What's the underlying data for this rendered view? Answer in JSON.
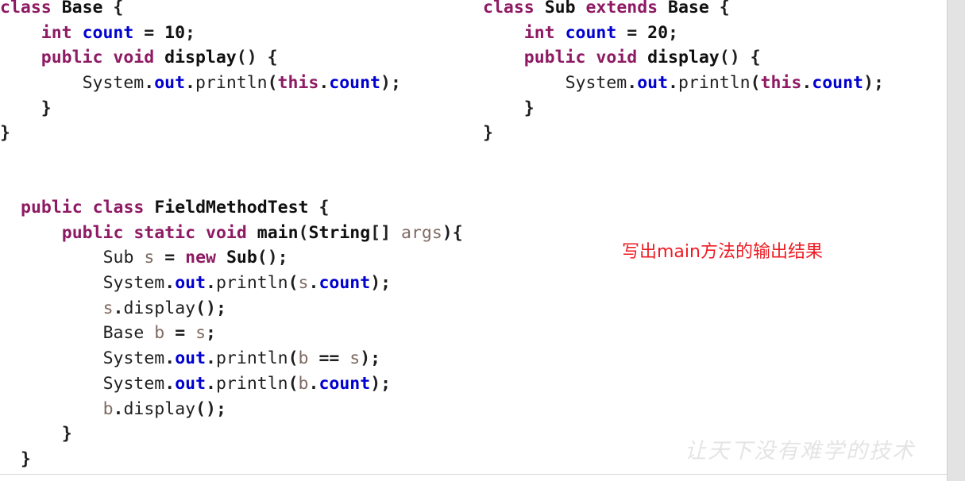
{
  "slide": {
    "background_color": "#ffffff",
    "gutter_color": "#e3e3e3",
    "rule_color": "#d4d4d4"
  },
  "palette": {
    "keyword": "#8E1A63",
    "identifier": "#101010",
    "plain": "#1f1f1f",
    "field": "#0000D0",
    "variable": "#7E6A62",
    "annotation_red": "#ED1C24",
    "watermark_gray": "#e4e4e4"
  },
  "code_blocks": [
    {
      "id": "block-base",
      "name": "base-class-code",
      "lines": [
        [
          {
            "t": "class",
            "c": "kw"
          },
          {
            "t": " ",
            "c": "plain"
          },
          {
            "t": "Base",
            "c": "id"
          },
          {
            "t": " ",
            "c": "plain"
          },
          {
            "t": "{",
            "c": "punc"
          }
        ],
        [
          {
            "t": "    ",
            "c": "plain"
          },
          {
            "t": "int",
            "c": "kw"
          },
          {
            "t": " ",
            "c": "plain"
          },
          {
            "t": "count",
            "c": "field"
          },
          {
            "t": " = ",
            "c": "punc"
          },
          {
            "t": "10",
            "c": "num"
          },
          {
            "t": ";",
            "c": "punc"
          }
        ],
        [
          {
            "t": "    ",
            "c": "plain"
          },
          {
            "t": "public",
            "c": "kw"
          },
          {
            "t": " ",
            "c": "plain"
          },
          {
            "t": "void",
            "c": "kw"
          },
          {
            "t": " ",
            "c": "plain"
          },
          {
            "t": "display",
            "c": "id"
          },
          {
            "t": "() {",
            "c": "punc"
          }
        ],
        [
          {
            "t": "        ",
            "c": "plain"
          },
          {
            "t": "System",
            "c": "plain"
          },
          {
            "t": ".",
            "c": "punc"
          },
          {
            "t": "out",
            "c": "field"
          },
          {
            "t": ".",
            "c": "punc"
          },
          {
            "t": "println",
            "c": "plain"
          },
          {
            "t": "(",
            "c": "punc"
          },
          {
            "t": "this",
            "c": "kw"
          },
          {
            "t": ".",
            "c": "punc"
          },
          {
            "t": "count",
            "c": "field"
          },
          {
            "t": ");",
            "c": "punc"
          }
        ],
        [
          {
            "t": "    ",
            "c": "plain"
          },
          {
            "t": "}",
            "c": "punc"
          }
        ],
        [
          {
            "t": "}",
            "c": "punc"
          }
        ]
      ]
    },
    {
      "id": "block-sub",
      "name": "sub-class-code",
      "lines": [
        [
          {
            "t": "class",
            "c": "kw"
          },
          {
            "t": " ",
            "c": "plain"
          },
          {
            "t": "Sub",
            "c": "id"
          },
          {
            "t": " ",
            "c": "plain"
          },
          {
            "t": "extends",
            "c": "kw"
          },
          {
            "t": " ",
            "c": "plain"
          },
          {
            "t": "Base",
            "c": "id"
          },
          {
            "t": " ",
            "c": "plain"
          },
          {
            "t": "{",
            "c": "punc"
          }
        ],
        [
          {
            "t": "    ",
            "c": "plain"
          },
          {
            "t": "int",
            "c": "kw"
          },
          {
            "t": " ",
            "c": "plain"
          },
          {
            "t": "count",
            "c": "field"
          },
          {
            "t": " = ",
            "c": "punc"
          },
          {
            "t": "20",
            "c": "num"
          },
          {
            "t": ";",
            "c": "punc"
          }
        ],
        [
          {
            "t": "    ",
            "c": "plain"
          },
          {
            "t": "public",
            "c": "kw"
          },
          {
            "t": " ",
            "c": "plain"
          },
          {
            "t": "void",
            "c": "kw"
          },
          {
            "t": " ",
            "c": "plain"
          },
          {
            "t": "display",
            "c": "id"
          },
          {
            "t": "() {",
            "c": "punc"
          }
        ],
        [
          {
            "t": "        ",
            "c": "plain"
          },
          {
            "t": "System",
            "c": "plain"
          },
          {
            "t": ".",
            "c": "punc"
          },
          {
            "t": "out",
            "c": "field"
          },
          {
            "t": ".",
            "c": "punc"
          },
          {
            "t": "println",
            "c": "plain"
          },
          {
            "t": "(",
            "c": "punc"
          },
          {
            "t": "this",
            "c": "kw"
          },
          {
            "t": ".",
            "c": "punc"
          },
          {
            "t": "count",
            "c": "field"
          },
          {
            "t": ");",
            "c": "punc"
          }
        ],
        [
          {
            "t": "    ",
            "c": "plain"
          },
          {
            "t": "}",
            "c": "punc"
          }
        ],
        [
          {
            "t": "}",
            "c": "punc"
          }
        ]
      ]
    },
    {
      "id": "block-main",
      "name": "field-method-test-code",
      "lines": [
        [
          {
            "t": "public",
            "c": "kw"
          },
          {
            "t": " ",
            "c": "plain"
          },
          {
            "t": "class",
            "c": "kw"
          },
          {
            "t": " ",
            "c": "plain"
          },
          {
            "t": "FieldMethodTest",
            "c": "id"
          },
          {
            "t": " ",
            "c": "plain"
          },
          {
            "t": "{",
            "c": "punc"
          }
        ],
        [
          {
            "t": "    ",
            "c": "plain"
          },
          {
            "t": "public",
            "c": "kw"
          },
          {
            "t": " ",
            "c": "plain"
          },
          {
            "t": "static",
            "c": "kw"
          },
          {
            "t": " ",
            "c": "plain"
          },
          {
            "t": "void",
            "c": "kw"
          },
          {
            "t": " ",
            "c": "plain"
          },
          {
            "t": "main",
            "c": "id"
          },
          {
            "t": "(",
            "c": "punc"
          },
          {
            "t": "String",
            "c": "id"
          },
          {
            "t": "[] ",
            "c": "punc"
          },
          {
            "t": "args",
            "c": "var"
          },
          {
            "t": "){",
            "c": "punc"
          }
        ],
        [
          {
            "t": "        ",
            "c": "plain"
          },
          {
            "t": "Sub",
            "c": "plain"
          },
          {
            "t": " ",
            "c": "plain"
          },
          {
            "t": "s",
            "c": "var"
          },
          {
            "t": " = ",
            "c": "punc"
          },
          {
            "t": "new",
            "c": "kw"
          },
          {
            "t": " ",
            "c": "plain"
          },
          {
            "t": "Sub",
            "c": "id"
          },
          {
            "t": "();",
            "c": "punc"
          }
        ],
        [
          {
            "t": "        ",
            "c": "plain"
          },
          {
            "t": "System",
            "c": "plain"
          },
          {
            "t": ".",
            "c": "punc"
          },
          {
            "t": "out",
            "c": "field"
          },
          {
            "t": ".",
            "c": "punc"
          },
          {
            "t": "println",
            "c": "plain"
          },
          {
            "t": "(",
            "c": "punc"
          },
          {
            "t": "s",
            "c": "var"
          },
          {
            "t": ".",
            "c": "punc"
          },
          {
            "t": "count",
            "c": "field"
          },
          {
            "t": ");",
            "c": "punc"
          }
        ],
        [
          {
            "t": "        ",
            "c": "plain"
          },
          {
            "t": "s",
            "c": "var"
          },
          {
            "t": ".",
            "c": "punc"
          },
          {
            "t": "display",
            "c": "plain"
          },
          {
            "t": "();",
            "c": "punc"
          }
        ],
        [
          {
            "t": "        ",
            "c": "plain"
          },
          {
            "t": "Base",
            "c": "plain"
          },
          {
            "t": " ",
            "c": "plain"
          },
          {
            "t": "b",
            "c": "var"
          },
          {
            "t": " = ",
            "c": "punc"
          },
          {
            "t": "s",
            "c": "var"
          },
          {
            "t": ";",
            "c": "punc"
          }
        ],
        [
          {
            "t": "        ",
            "c": "plain"
          },
          {
            "t": "System",
            "c": "plain"
          },
          {
            "t": ".",
            "c": "punc"
          },
          {
            "t": "out",
            "c": "field"
          },
          {
            "t": ".",
            "c": "punc"
          },
          {
            "t": "println",
            "c": "plain"
          },
          {
            "t": "(",
            "c": "punc"
          },
          {
            "t": "b",
            "c": "var"
          },
          {
            "t": " == ",
            "c": "punc"
          },
          {
            "t": "s",
            "c": "var"
          },
          {
            "t": ");",
            "c": "punc"
          }
        ],
        [
          {
            "t": "        ",
            "c": "plain"
          },
          {
            "t": "System",
            "c": "plain"
          },
          {
            "t": ".",
            "c": "punc"
          },
          {
            "t": "out",
            "c": "field"
          },
          {
            "t": ".",
            "c": "punc"
          },
          {
            "t": "println",
            "c": "plain"
          },
          {
            "t": "(",
            "c": "punc"
          },
          {
            "t": "b",
            "c": "var"
          },
          {
            "t": ".",
            "c": "punc"
          },
          {
            "t": "count",
            "c": "field"
          },
          {
            "t": ");",
            "c": "punc"
          }
        ],
        [
          {
            "t": "        ",
            "c": "plain"
          },
          {
            "t": "b",
            "c": "var"
          },
          {
            "t": ".",
            "c": "punc"
          },
          {
            "t": "display",
            "c": "plain"
          },
          {
            "t": "();",
            "c": "punc"
          }
        ],
        [
          {
            "t": "    ",
            "c": "plain"
          },
          {
            "t": "}",
            "c": "punc"
          }
        ],
        [
          {
            "t": "}",
            "c": "punc"
          }
        ]
      ]
    }
  ],
  "annotation": {
    "text": "写出main方法的输出结果"
  },
  "watermark": {
    "text": "让天下没有难学的技术"
  }
}
